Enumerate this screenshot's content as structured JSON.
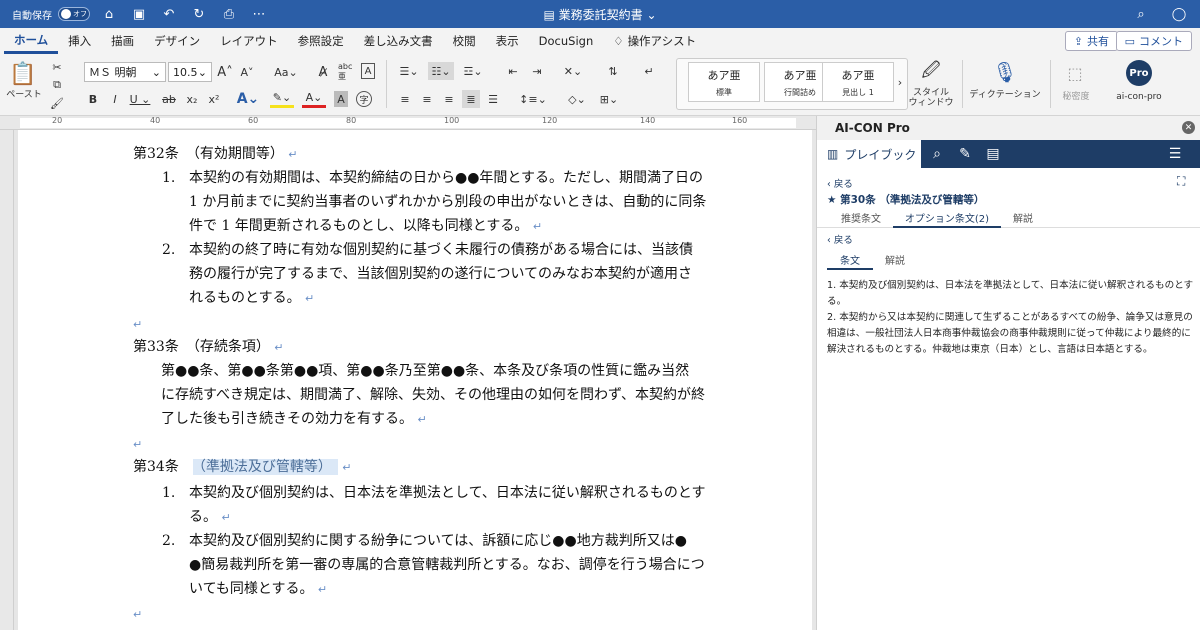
{
  "titlebar": {
    "autosave_label": "自動保存",
    "autosave_state": "オフ",
    "doc_title": "業務委託契約書"
  },
  "tabs": [
    {
      "label": "ホーム",
      "active": true
    },
    {
      "label": "挿入"
    },
    {
      "label": "描画"
    },
    {
      "label": "デザイン"
    },
    {
      "label": "レイアウト"
    },
    {
      "label": "参照設定"
    },
    {
      "label": "差し込み文書"
    },
    {
      "label": "校閲"
    },
    {
      "label": "表示"
    },
    {
      "label": "DocuSign"
    },
    {
      "label": "操作アシスト"
    }
  ],
  "share_label": "共有",
  "comment_label": "コメント",
  "ribbon": {
    "paste_label": "ペースト",
    "font_name": "ＭＳ 明朝",
    "font_size": "10.5",
    "styles": [
      {
        "preview": "あア亜",
        "name": "標準"
      },
      {
        "preview": "あア亜",
        "name": "行間詰め"
      },
      {
        "preview": "あア亜",
        "name": "見出し 1"
      }
    ],
    "style_window_label": "スタイル\nウィンドウ",
    "dictation_label": "ディクテーション",
    "sensitivity_label": "秘密度",
    "addin_badge": "Pro",
    "addin_label": "ai-con-pro"
  },
  "ruler": {
    "marks": [
      "20",
      "40",
      "60",
      "80",
      "100",
      "120",
      "140",
      "160"
    ]
  },
  "document": {
    "lines": [
      {
        "text": "第32条　（有効期間等）",
        "mark": "↵"
      },
      {
        "num": "1.",
        "text": "本契約の有効期間は、本契約締結の日から●●年間とする。ただし、期間満了日の"
      },
      {
        "text": "1 か月前までに契約当事者のいずれかから別段の申出がないときは、自動的に同条"
      },
      {
        "text": "件で 1 年間更新されるものとし、以降も同様とする。",
        "mark": "↵"
      },
      {
        "num": "2.",
        "text": "本契約の終了時に有効な個別契約に基づく未履行の債務がある場合には、当該債"
      },
      {
        "text": "務の履行が完了するまで、当該個別契約の遂行についてのみなお本契約が適用さ"
      },
      {
        "text": "れるものとする。",
        "mark": "↵"
      },
      {
        "text": "",
        "mark": "↵"
      },
      {
        "text": "第33条　（存続条項）",
        "mark": "↵"
      },
      {
        "text": "第●●条、第●●条第●●項、第●●条乃至第●●条、本条及び条項の性質に鑑み当然"
      },
      {
        "text": "に存続すべき規定は、期間満了、解除、失効、その他理由の如何を問わず、本契約が終"
      },
      {
        "text": "了した後も引き続きその効力を有する。",
        "mark": "↵"
      },
      {
        "text": "",
        "mark": "↵"
      },
      {
        "text": "第34条",
        "highlight": "（準拠法及び管轄等）",
        "mark": "↵"
      },
      {
        "num": "1.",
        "text": "本契約及び個別契約は、日本法を準拠法として、日本法に従い解釈されるものとす"
      },
      {
        "text": "る。",
        "mark": "↵"
      },
      {
        "num": "2.",
        "text": "本契約及び個別契約に関する紛争については、訴額に応じ●●地方裁判所又は●"
      },
      {
        "text": "●簡易裁判所を第一審の専属的合意管轄裁判所とする。なお、調停を行う場合につ"
      },
      {
        "text": "いても同様とする。",
        "mark": "↵"
      },
      {
        "text": "",
        "mark": "↵"
      }
    ]
  },
  "panel": {
    "title": "AI-CON Pro",
    "nav_playbook": "プレイブック",
    "back_label": "戻る",
    "clause_title": "第30条 （準拠法及び管轄等）",
    "tabs": [
      {
        "label": "推奨条文"
      },
      {
        "label": "オプション条文(2)",
        "active": true
      },
      {
        "label": "解説"
      }
    ],
    "back_label2": "戻る",
    "subtabs": [
      {
        "label": "条文",
        "active": true
      },
      {
        "label": "解説"
      }
    ],
    "clause_paragraphs": [
      "1. 本契約及び個別契約は、日本法を準拠法として、日本法に従い解釈されるものとする。",
      "2. 本契約から又は本契約に関連して生ずることがあるすべての紛争、論争又は意見の相違は、一般社団法人日本商事仲裁協会の商事仲裁規則に従って仲裁により最終的に解決されるものとする。仲裁地は東京（日本）とし、言語は日本語とする。"
    ]
  }
}
